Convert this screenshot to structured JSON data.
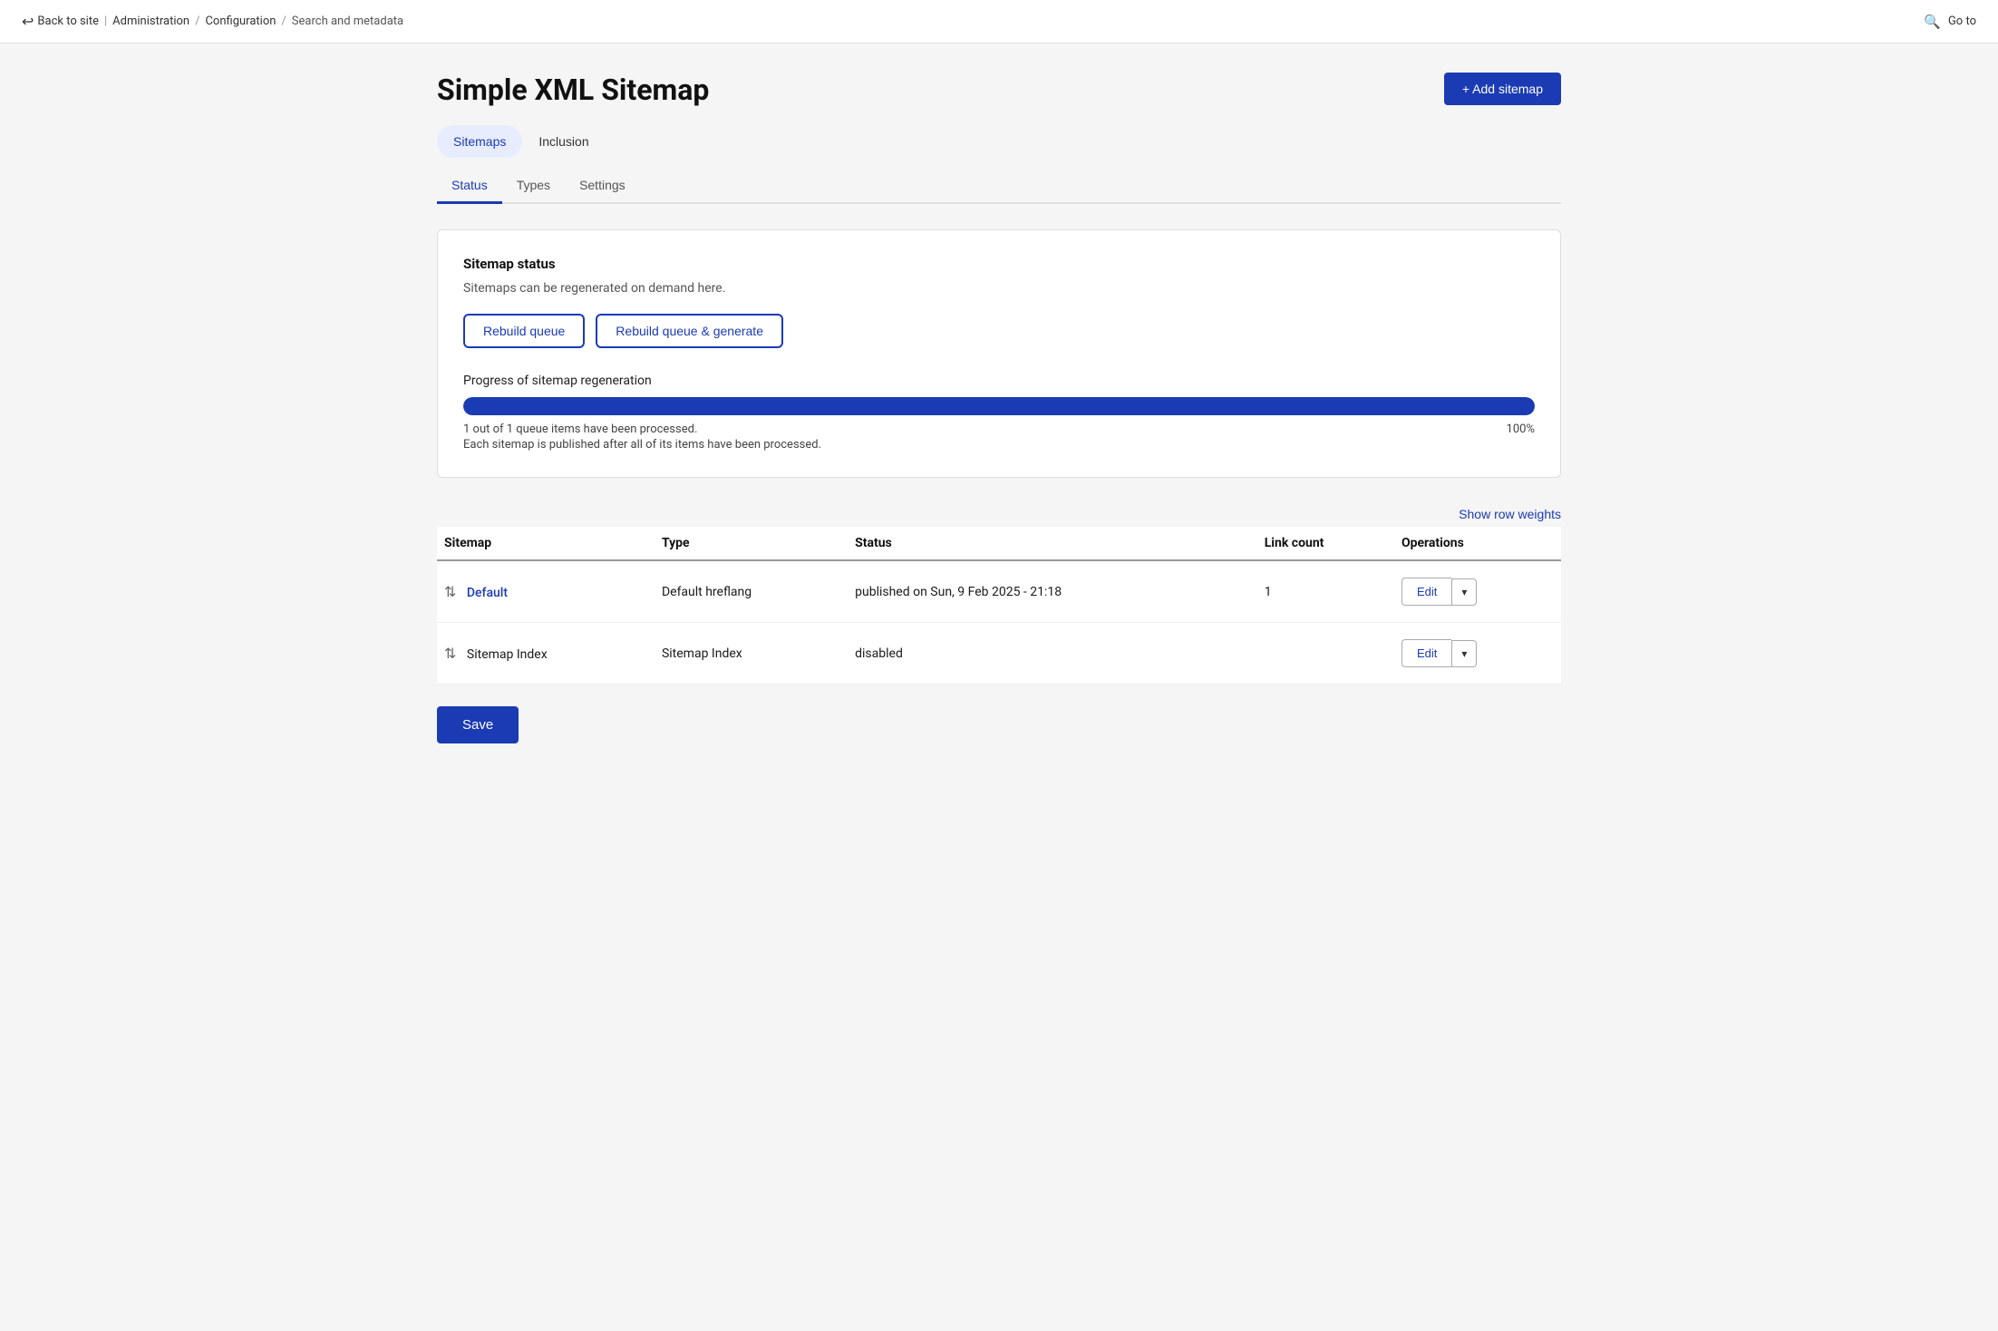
{
  "topbar": {
    "back_label": "Back to site",
    "breadcrumb": [
      "Administration",
      "Configuration",
      "Search and metadata"
    ],
    "goto_label": "Go to"
  },
  "page": {
    "title": "Simple XML Sitemap",
    "add_button": "+ Add sitemap"
  },
  "nav_tabs": [
    {
      "label": "Sitemaps",
      "active": true
    },
    {
      "label": "Inclusion",
      "active": false
    }
  ],
  "sub_tabs": [
    {
      "label": "Status",
      "active": true
    },
    {
      "label": "Types",
      "active": false
    },
    {
      "label": "Settings",
      "active": false
    }
  ],
  "sitemap_status": {
    "title": "Sitemap status",
    "description": "Sitemaps can be regenerated on demand here.",
    "rebuild_queue_label": "Rebuild queue",
    "rebuild_generate_label": "Rebuild queue & generate",
    "progress_title": "Progress of sitemap regeneration",
    "progress_value": 100,
    "progress_text1": "1 out of 1 queue items have been processed.",
    "progress_text2": "Each sitemap is published after all of its items have been processed.",
    "progress_percent": "100%"
  },
  "table": {
    "show_row_weights_label": "Show row weights",
    "columns": [
      "Sitemap",
      "Type",
      "Status",
      "Link count",
      "Operations"
    ],
    "rows": [
      {
        "sitemap": "Default",
        "is_link": true,
        "type": "Default hreflang",
        "status": "published on Sun, 9 Feb 2025 - 21:18",
        "link_count": "1",
        "edit_label": "Edit"
      },
      {
        "sitemap": "Sitemap Index",
        "is_link": false,
        "type": "Sitemap Index",
        "status": "disabled",
        "link_count": "",
        "edit_label": "Edit"
      }
    ]
  },
  "footer": {
    "save_label": "Save"
  }
}
